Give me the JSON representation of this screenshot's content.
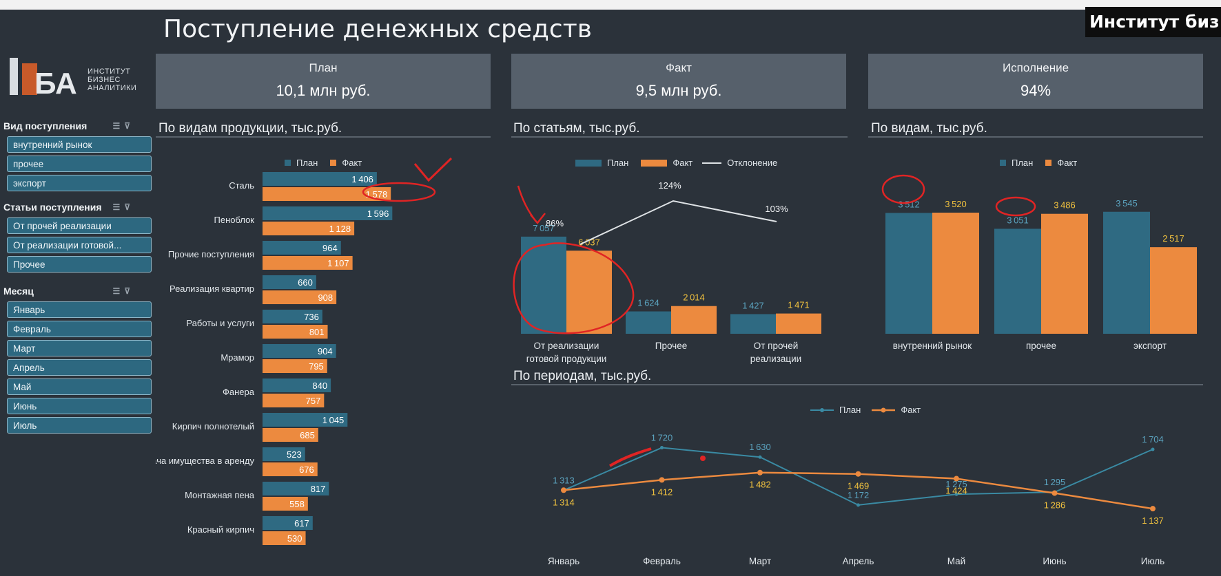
{
  "overlay": {
    "text": "Институт биз..."
  },
  "page": {
    "title": "Поступление денежных средств"
  },
  "logo": {
    "mark": "ИБА",
    "line1": "ИНСТИТУТ",
    "line2": "БИЗНЕС",
    "line3": "АНАЛИТИКИ"
  },
  "kpis": [
    {
      "label": "План",
      "value": "10,1  млн руб."
    },
    {
      "label": "Факт",
      "value": "9,5  млн руб."
    },
    {
      "label": "Исполнение",
      "value": "94%"
    }
  ],
  "slicers": [
    {
      "title": "Вид поступления",
      "items": [
        "внутренний рынок",
        "прочее",
        "экспорт"
      ]
    },
    {
      "title": "Статьи поступления",
      "items": [
        "От прочей реализации",
        "От реализации готовой...",
        "Прочее"
      ]
    },
    {
      "title": "Месяц",
      "items": [
        "Январь",
        "Февраль",
        "Март",
        "Апрель",
        "Май",
        "Июнь",
        "Июль"
      ]
    }
  ],
  "legend": {
    "plan": "План",
    "fact": "Факт",
    "deviation": "Отклонение"
  },
  "colors": {
    "plan": "#2f6a82",
    "fact": "#ec8a3f",
    "background": "#2b323a",
    "annotation": "#e02424"
  },
  "sections": {
    "by_product": "По видам продукции, тыс.руб.",
    "by_article": "По статьям, тыс.руб.",
    "by_type": "По видам, тыс.руб.",
    "by_period": "По периодам, тыс.руб."
  },
  "chart_data": [
    {
      "type": "bar",
      "orientation": "horizontal",
      "title": "По видам продукции, тыс.руб.",
      "categories": [
        "Сталь",
        "Пеноблок",
        "Прочие поступления",
        "Реализация квартир",
        "Работы и услуги",
        "Мрамор",
        "Фанера",
        "Кирпич полнотелый",
        "Сдача имущества в аренду",
        "Монтажная пена",
        "Красный кирпич"
      ],
      "series": [
        {
          "name": "План",
          "values": [
            1406,
            1596,
            964,
            660,
            736,
            904,
            840,
            1045,
            523,
            817,
            617
          ]
        },
        {
          "name": "Факт",
          "values": [
            1578,
            1128,
            1107,
            908,
            801,
            795,
            757,
            685,
            676,
            558,
            530
          ]
        }
      ]
    },
    {
      "type": "bar",
      "title": "По статьям, тыс.руб.",
      "categories": [
        "От реализации готовой продукции",
        "Прочее",
        "От прочей реализации"
      ],
      "series": [
        {
          "name": "План",
          "values": [
            7057,
            1624,
            1427
          ]
        },
        {
          "name": "Факт",
          "values": [
            6037,
            2014,
            1471
          ]
        },
        {
          "name": "Отклонение",
          "values": [
            "86%",
            "124%",
            "103%"
          ]
        }
      ]
    },
    {
      "type": "bar",
      "title": "По видам, тыс.руб.",
      "categories": [
        "внутренний рынок",
        "прочее",
        "экспорт"
      ],
      "series": [
        {
          "name": "План",
          "values": [
            3512,
            3051,
            3545
          ]
        },
        {
          "name": "Факт",
          "values": [
            3520,
            3486,
            2517
          ]
        }
      ]
    },
    {
      "type": "line",
      "title": "По периодам, тыс.руб.",
      "categories": [
        "Январь",
        "Февраль",
        "Март",
        "Апрель",
        "Май",
        "Июнь",
        "Июль"
      ],
      "series": [
        {
          "name": "План",
          "values": [
            1313,
            1720,
            1630,
            1172,
            1275,
            1295,
            1704
          ]
        },
        {
          "name": "Факт",
          "values": [
            1314,
            1412,
            1482,
            1469,
            1424,
            1286,
            1137
          ]
        }
      ]
    }
  ]
}
